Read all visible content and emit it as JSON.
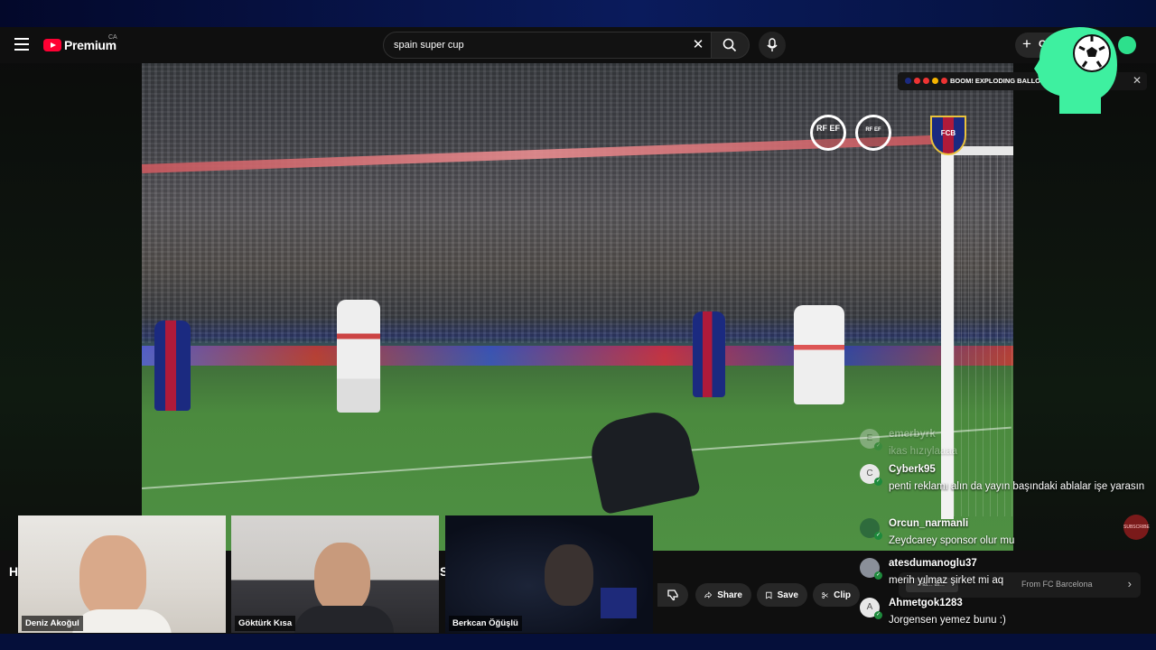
{
  "masthead": {
    "logo_text": "Premium",
    "region": "CA",
    "search_query": "spain super cup",
    "create_label": "C"
  },
  "video": {
    "badge_rfef": "RF EF",
    "badge_super": "RF EF",
    "crest_text": "FCB"
  },
  "notification": {
    "text": "BOOM! EXPLODING BALLO... H S..."
  },
  "below": {
    "title_fragment_left": "H",
    "title_fragment_right": "S",
    "actions": [
      {
        "label": "Share",
        "icon": "share-icon"
      },
      {
        "label": "Save",
        "icon": "save-icon"
      },
      {
        "label": "Clip",
        "icon": "scissors-icon"
      }
    ],
    "suggestion_chip": "Ha... ai...",
    "suggestion_from": "From FC Barcelona"
  },
  "chat": [
    {
      "user": "emerbyrk",
      "text": "ikas hızıylaaaa",
      "initial": "E",
      "faded": true
    },
    {
      "user": "Cyberk95",
      "text": "penti reklamı alın da yayın başındaki ablalar işe yarasın",
      "initial": "C"
    },
    {
      "user": "Orcun_narmanli",
      "text": "Zeydcarey sponsor olur mu",
      "initial": ""
    },
    {
      "user": "atesdumanoglu37",
      "text": "merih yılmaz şirket mi aq",
      "initial": ""
    },
    {
      "user": "Ahmetgok1283",
      "text": "Jorgensen yemez bunu :)",
      "initial": "A"
    }
  ],
  "cameras": [
    {
      "name": "Deniz Akoğul"
    },
    {
      "name": "Göktürk Kısa"
    },
    {
      "name": "Berkcan Öğüşlü"
    }
  ],
  "record_badge": "SUBSCRIBE",
  "colors": {
    "brand_red": "#ff0033",
    "logo_green": "#2de08c",
    "barca_blue": "#1b2a80",
    "barca_red": "#b01a3a"
  }
}
